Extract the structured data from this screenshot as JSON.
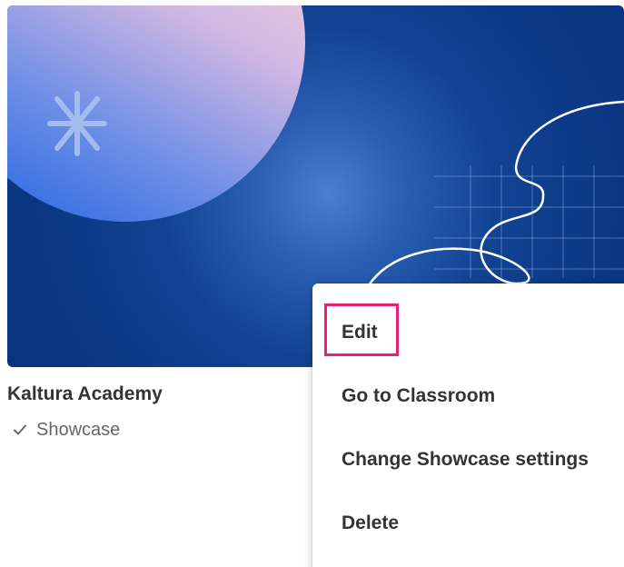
{
  "card": {
    "title": "Kaltura Academy",
    "badge_icon": "check-icon",
    "badge_label": "Showcase",
    "banner_colors": {
      "background": "#0b3784",
      "glow": "#4a7fcd",
      "circle_top": "#f8d0d8",
      "circle_bottom": "#2f6be0"
    }
  },
  "context_menu": {
    "items": [
      {
        "label": "Edit",
        "highlighted": true
      },
      {
        "label": "Go to Classroom"
      },
      {
        "label": "Change Showcase settings"
      },
      {
        "label": "Delete"
      }
    ],
    "highlight_color": "#e3217d"
  }
}
